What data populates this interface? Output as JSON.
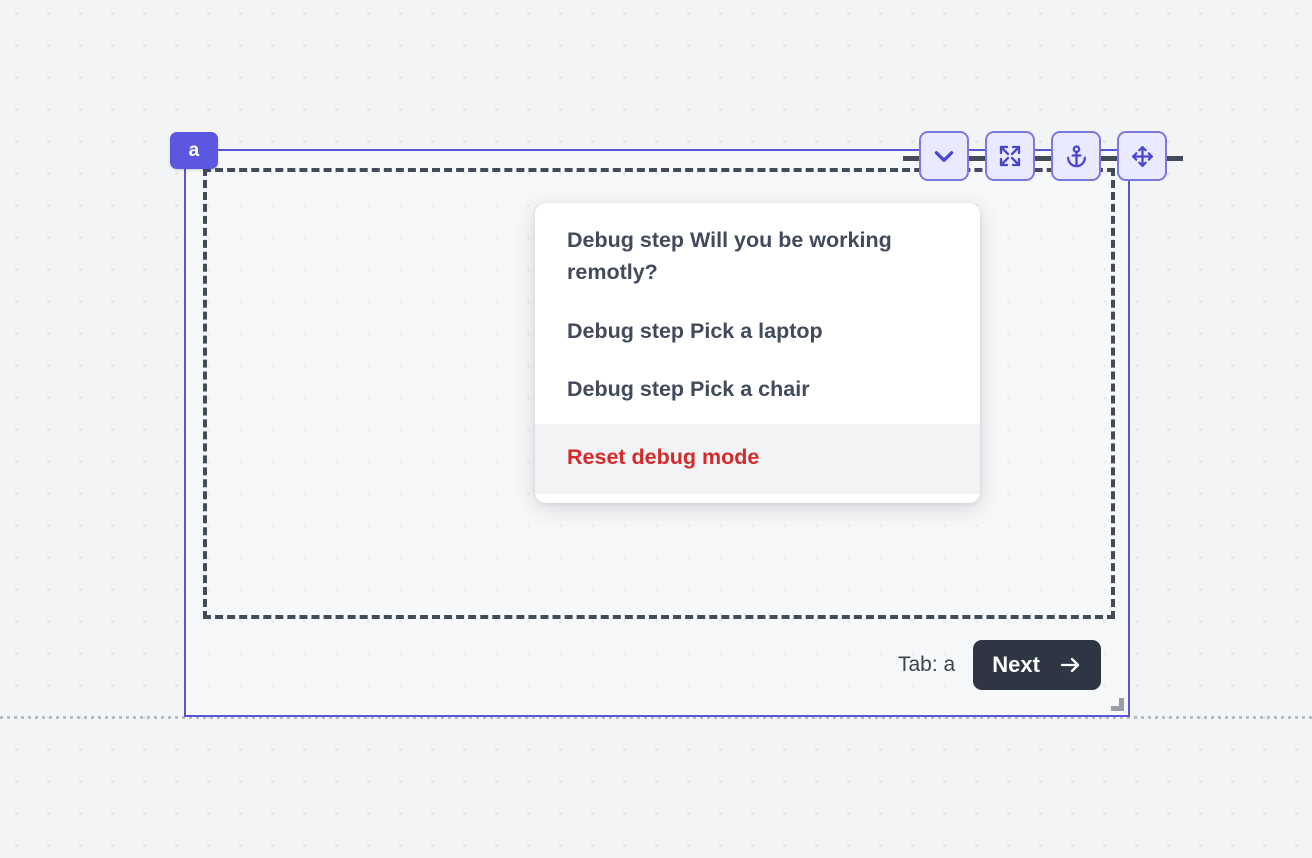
{
  "canvas": {
    "background_color": "#f3f4f6",
    "dot_color": "#e2e4e8"
  },
  "selection": {
    "accent_color": "#5956d6",
    "tab_pill_label": "a",
    "resize_handle_name": "resize-handle"
  },
  "drop_zone": {
    "border_color": "#434a59",
    "style": "dashed"
  },
  "toolbar": {
    "buttons": [
      {
        "name": "collapse-button",
        "icon": "chevron-down-icon",
        "label": "Collapse"
      },
      {
        "name": "expand-button",
        "icon": "expand-arrows-icon",
        "label": "Expand"
      },
      {
        "name": "anchor-button",
        "icon": "anchor-icon",
        "label": "Anchor"
      },
      {
        "name": "move-button",
        "icon": "move-arrows-icon",
        "label": "Move"
      }
    ],
    "icon_color": "#4a46d0",
    "button_fill": "#e9eaff",
    "button_border": "#7b78e4"
  },
  "debug_menu": {
    "items": [
      {
        "label": "Debug step Will you be working remotly?",
        "variant": "normal"
      },
      {
        "label": "Debug step Pick a laptop",
        "variant": "normal"
      },
      {
        "label": "Debug step Pick a chair",
        "variant": "normal"
      },
      {
        "label": "Reset debug mode",
        "variant": "danger"
      }
    ],
    "text_color": "#434a5c",
    "danger_color": "#d42a2a",
    "highlight_background": "#f1f3f5"
  },
  "footer": {
    "tab_indicator": "Tab: a",
    "next_label": "Next",
    "next_icon": "arrow-right-icon",
    "next_background": "#2f3643"
  }
}
